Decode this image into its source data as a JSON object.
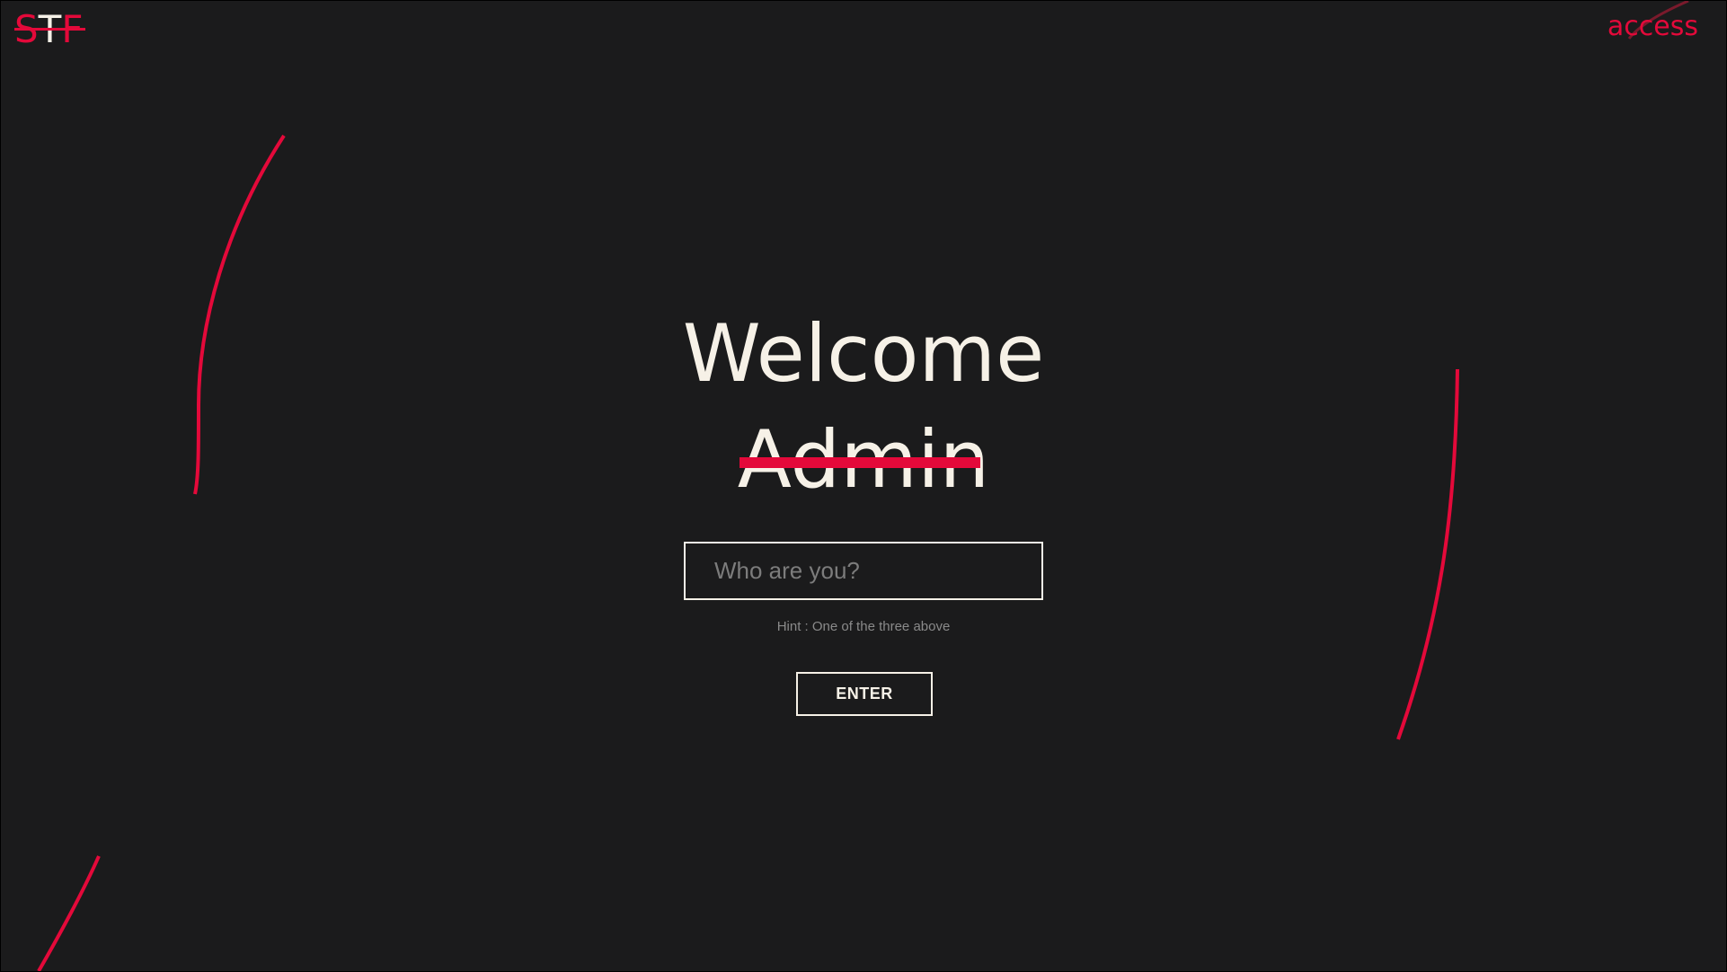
{
  "brand": {
    "logo_first": "S",
    "logo_middle": "T",
    "logo_last": "F"
  },
  "nav": {
    "access_label": "access"
  },
  "hero": {
    "welcome": "Welcome",
    "struck_word": "Admin"
  },
  "form": {
    "placeholder": "Who are you?",
    "value": "",
    "hint": "Hint : One of the three above",
    "enter_label": "ENTER"
  },
  "colors": {
    "background": "#1b1b1c",
    "accent": "#e4093a",
    "text": "#f6f1e7",
    "muted": "#8a8a8a"
  }
}
